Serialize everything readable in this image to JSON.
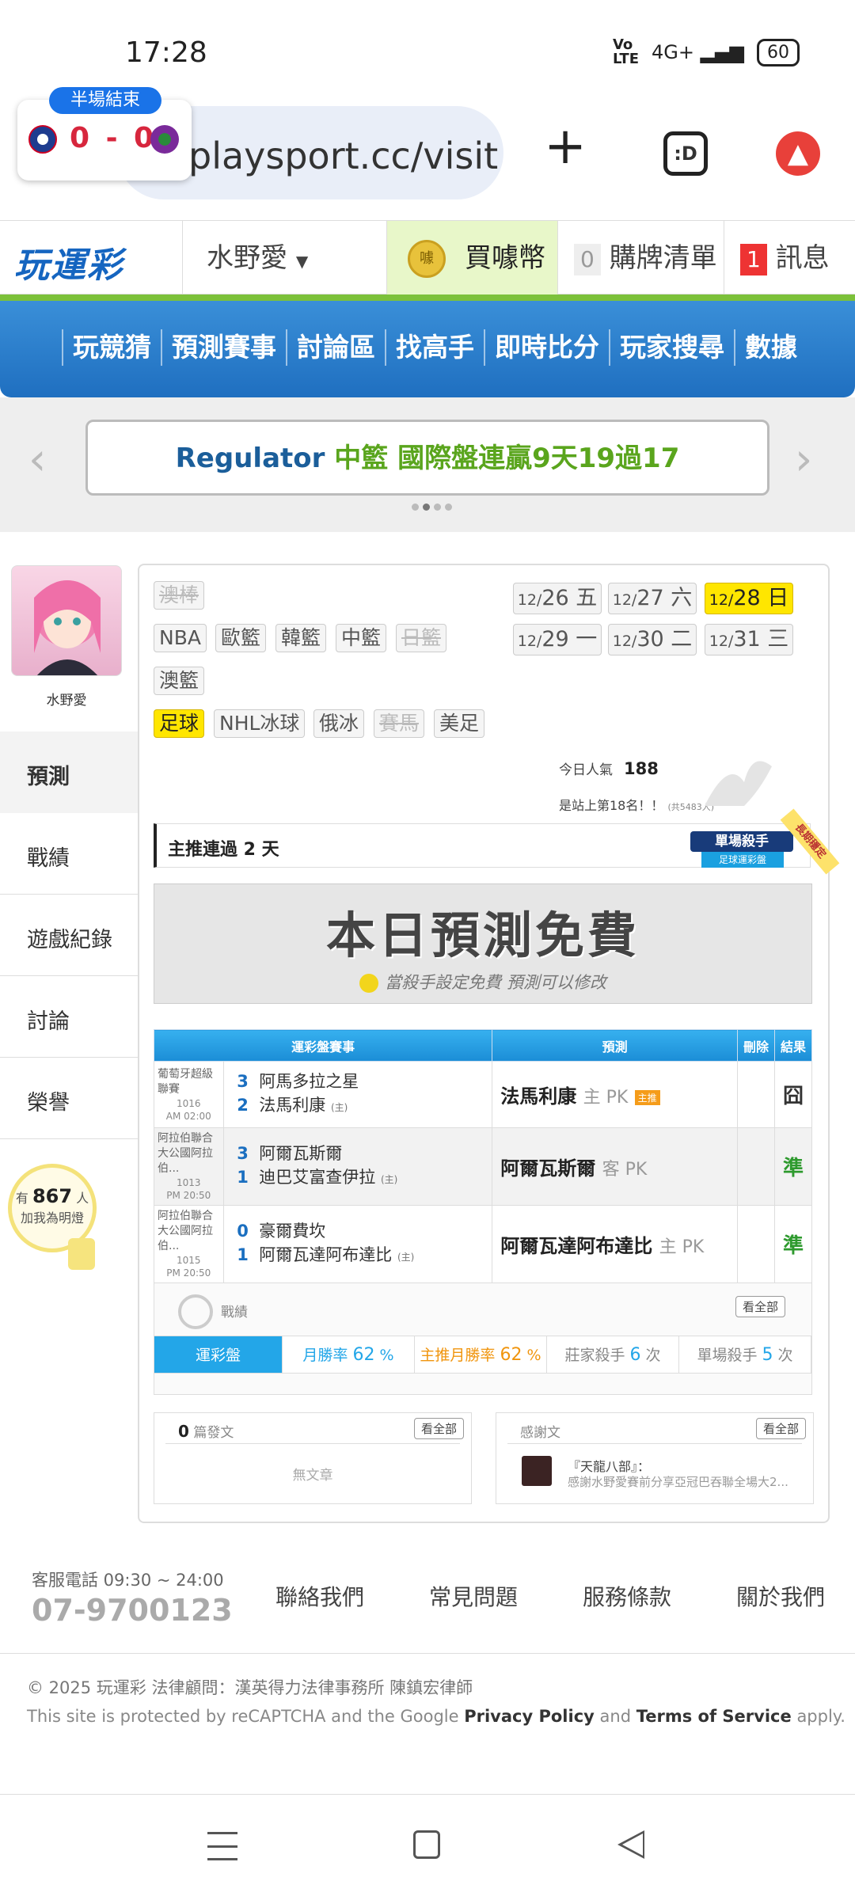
{
  "status_bar": {
    "time": "17:28",
    "network": "4G+",
    "battery": "60"
  },
  "browser": {
    "url": "playsport.cc/visit",
    "score_badge": {
      "label": "半場結束",
      "score": "0 - 0"
    }
  },
  "header": {
    "logo": "玩運彩",
    "username": "水野愛",
    "coin_icon": "噱",
    "coin_label": "買噱幣",
    "cart_count": "0",
    "cart_label": "購牌清單",
    "msg_count": "1",
    "msg_label": "訊息"
  },
  "nav": {
    "items": [
      "玩競猜",
      "預測賽事",
      "討論區",
      "找高手",
      "即時比分",
      "玩家搜尋",
      "數據"
    ]
  },
  "carousel": {
    "text_a": "Regulator",
    "text_b": "中籃 國際盤連贏9天19過17"
  },
  "sidebar": {
    "avatar_name": "水野愛",
    "menu": [
      "預測",
      "戰績",
      "遊戲紀錄",
      "討論",
      "榮譽"
    ],
    "fans": {
      "prefix": "有",
      "count": "867",
      "unit": "人",
      "label": "加我為明燈"
    }
  },
  "leagues": [
    "澳棒",
    "NBA",
    "歐籃",
    "韓籃",
    "中籃",
    "日籃",
    "澳籃",
    "足球",
    "NHL冰球",
    "俄冰",
    "賽馬",
    "美足"
  ],
  "dates": [
    {
      "md": "12/",
      "d": "26",
      "w": "五"
    },
    {
      "md": "12/",
      "d": "27",
      "w": "六"
    },
    {
      "md": "12/",
      "d": "28",
      "w": "日"
    },
    {
      "md": "12/",
      "d": "29",
      "w": "一"
    },
    {
      "md": "12/",
      "d": "30",
      "w": "二"
    },
    {
      "md": "12/",
      "d": "31",
      "w": "三"
    }
  ],
  "popularity": {
    "label": "今日人氣",
    "value": "188",
    "rank_text": "是站上第18名！！",
    "rank_note": "(共5483人)"
  },
  "streak": {
    "text": "主推連過 2 天",
    "badge_a": "單場殺手",
    "badge_b": "足球運彩盤",
    "badge_c": "長期穩定"
  },
  "free_banner": {
    "title": "本日預測免費",
    "subtitle": "當殺手設定免費 預測可以修改"
  },
  "table": {
    "headers": [
      "運彩盤賽事",
      "預測",
      "刪除",
      "結果"
    ],
    "rows": [
      {
        "league": "葡萄牙超級聯賽",
        "code": "1016",
        "time": "AM 02:00",
        "s1": "3",
        "t1": "阿馬多拉之星",
        "s2": "2",
        "t2": "法馬利康",
        "host": "(主)",
        "pick": "法馬利康",
        "pick_side": "主 PK",
        "tag": "主推",
        "result": "囧",
        "result_color": "#333"
      },
      {
        "league": "阿拉伯聯合大公國阿拉伯...",
        "code": "1013",
        "time": "PM 20:50",
        "s1": "3",
        "t1": "阿爾瓦斯爾",
        "s2": "1",
        "t2": "迪巴艾富查伊拉",
        "host": "(主)",
        "pick": "阿爾瓦斯爾",
        "pick_side": "客 PK",
        "tag": "",
        "result": "準",
        "result_color": "#2e9a2e"
      },
      {
        "league": "阿拉伯聯合大公國阿拉伯...",
        "code": "1015",
        "time": "PM 20:50",
        "s1": "0",
        "t1": "豪爾費坎",
        "s2": "1",
        "t2": "阿爾瓦達阿布達比",
        "host": "(主)",
        "pick": "阿爾瓦達阿布達比",
        "pick_side": "主 PK",
        "tag": "",
        "result": "準",
        "result_color": "#2e9a2e"
      }
    ]
  },
  "record": {
    "title": "戰績",
    "view_all": "看全部",
    "tab": "運彩盤",
    "month_label": "月勝率",
    "month_value": "62",
    "pct": "%",
    "main_label": "主推月勝率",
    "main_value": "62",
    "banker_label": "莊家殺手",
    "banker_value": "6",
    "times": "次",
    "single_label": "單場殺手",
    "single_value": "5"
  },
  "posts": {
    "count": "0",
    "label": "篇發文",
    "view_all": "看全部",
    "empty": "無文章"
  },
  "thanks": {
    "label": "感謝文",
    "view_all": "看全部",
    "title": "『天龍八部』：",
    "body": "感謝水野愛賽前分享亞冠巴吞聯全場大2..."
  },
  "footer": {
    "tel_label": "客服電話 09:30 ~ 24:00",
    "tel": "07-9700123",
    "links": [
      "聯絡我們",
      "常見問題",
      "服務條款",
      "關於我們"
    ],
    "copyright": "© 2025 玩運彩 法律顧問：漢英得力法律事務所 陳鎮宏律師",
    "recaptcha_a": "This site is protected by reCAPTCHA and the Google",
    "privacy": "Privacy Policy",
    "and": "and",
    "terms": "Terms of Service",
    "apply": "apply."
  }
}
